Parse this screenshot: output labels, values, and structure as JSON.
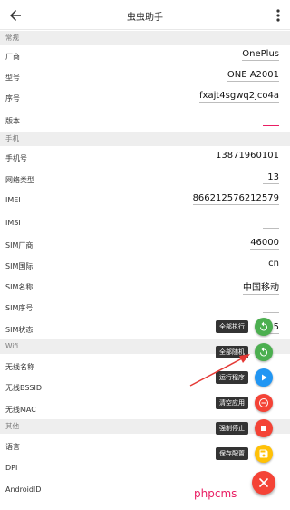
{
  "appbar": {
    "title": "虫虫助手"
  },
  "sections": {
    "general": "常规",
    "phone": "手机",
    "wifi": "Wifi",
    "other": "其他"
  },
  "general_rows": [
    {
      "label": "厂商",
      "value": "OnePlus"
    },
    {
      "label": "型号",
      "value": "ONE A2001"
    },
    {
      "label": "序号",
      "value": "fxajt4sgwq2jco4a"
    },
    {
      "label": "版本",
      "value": ""
    }
  ],
  "phone_rows": [
    {
      "label": "手机号",
      "value": "13871960101"
    },
    {
      "label": "网络类型",
      "value": "13"
    },
    {
      "label": "IMEI",
      "value": "866212576212579"
    },
    {
      "label": "IMSI",
      "value": ""
    },
    {
      "label": "SIM厂商",
      "value": "46000"
    },
    {
      "label": "SIM国际",
      "value": "cn"
    },
    {
      "label": "SIM名称",
      "value": "中国移动"
    },
    {
      "label": "SIM序号",
      "value": ""
    },
    {
      "label": "SIM状态",
      "value": "5"
    }
  ],
  "wifi_rows": [
    {
      "label": "无线名称",
      "value": ""
    },
    {
      "label": "无线BSSID",
      "value": ""
    },
    {
      "label": "无线MAC",
      "value": ""
    }
  ],
  "other_rows": [
    {
      "label": "语言",
      "value": ""
    },
    {
      "label": "DPI",
      "value": ""
    },
    {
      "label": "AndroidID",
      "value": ""
    }
  ],
  "fab_menu": [
    {
      "label": "全部执行",
      "icon": "refresh-icon",
      "color": "#4caf50"
    },
    {
      "label": "全部随机",
      "icon": "refresh-icon",
      "color": "#4caf50"
    },
    {
      "label": "运行程序",
      "icon": "play-icon",
      "color": "#2196f3"
    },
    {
      "label": "清空应用",
      "icon": "minus-circle-icon",
      "color": "#f44336"
    },
    {
      "label": "强制停止",
      "icon": "stop-icon",
      "color": "#f44336"
    },
    {
      "label": "保存配置",
      "icon": "save-icon",
      "color": "#ffc107"
    }
  ],
  "fab_main": {
    "icon": "close-icon",
    "color": "#f44336"
  },
  "watermark": "phpcms",
  "colors": {
    "accent": "#e91e63",
    "annotation_arrow": "#e53935"
  }
}
